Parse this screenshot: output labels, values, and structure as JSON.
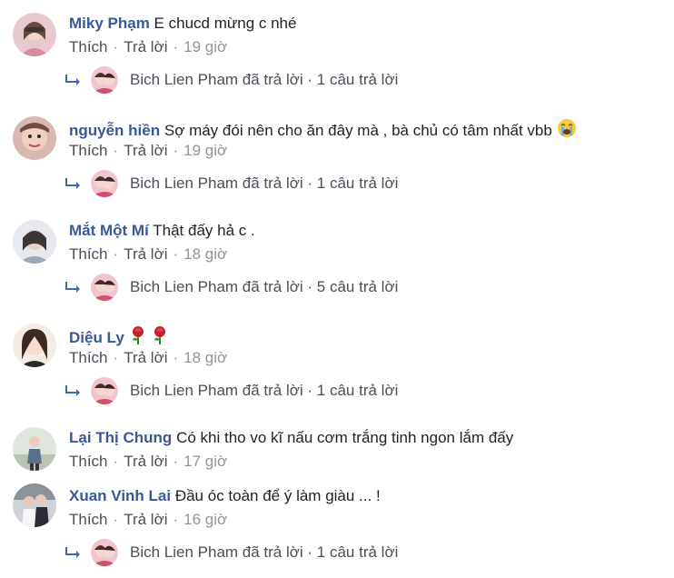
{
  "comments": [
    {
      "name": "Miky Phạm",
      "text": "E chucd mừng c nhé",
      "like": "Thích",
      "reply": "Trả lời",
      "time": "19 giờ",
      "reply_summary": "Bich Lien Pham đã trả lời · 1 câu trả lời"
    },
    {
      "name": "nguyễn hiền",
      "text": "Sợ máy đói nên cho ăn đây mà , bà chủ có tâm nhất vbb",
      "like": "Thích",
      "reply": "Trả lời",
      "time": "19 giờ",
      "reply_summary": "Bich Lien Pham đã trả lời · 1 câu trả lời"
    },
    {
      "name": "Mắt Một Mí",
      "text": "Thật đấy hả c .",
      "like": "Thích",
      "reply": "Trả lời",
      "time": "18 giờ",
      "reply_summary": "Bich Lien Pham đã trả lời · 5 câu trả lời"
    },
    {
      "name": "Diệu Ly",
      "text": "",
      "like": "Thích",
      "reply": "Trả lời",
      "time": "18 giờ",
      "reply_summary": "Bich Lien Pham đã trả lời · 1 câu trả lời"
    },
    {
      "name": "Lại Thị Chung",
      "text": "Có khi tho vo kĩ nấu cơm trắng tinh ngon lắm đấy",
      "like": "Thích",
      "reply": "Trả lời",
      "time": "17 giờ"
    },
    {
      "name": "Xuan Vinh Lai",
      "text": "Đầu óc toàn để ý làm giàu ... !",
      "like": "Thích",
      "reply": "Trả lời",
      "time": "16 giờ",
      "reply_summary": "Bich Lien Pham đã trả lời · 1 câu trả lời"
    }
  ],
  "colors": {
    "name": "#385898",
    "meta": "#90949c",
    "text": "#1d2129",
    "reply_arrow": "#4267b2"
  },
  "icons": {
    "reply_arrow": "reply-arrow-icon",
    "crying_emoji": "crying-face-icon",
    "rose_emoji": "rose-icon"
  }
}
